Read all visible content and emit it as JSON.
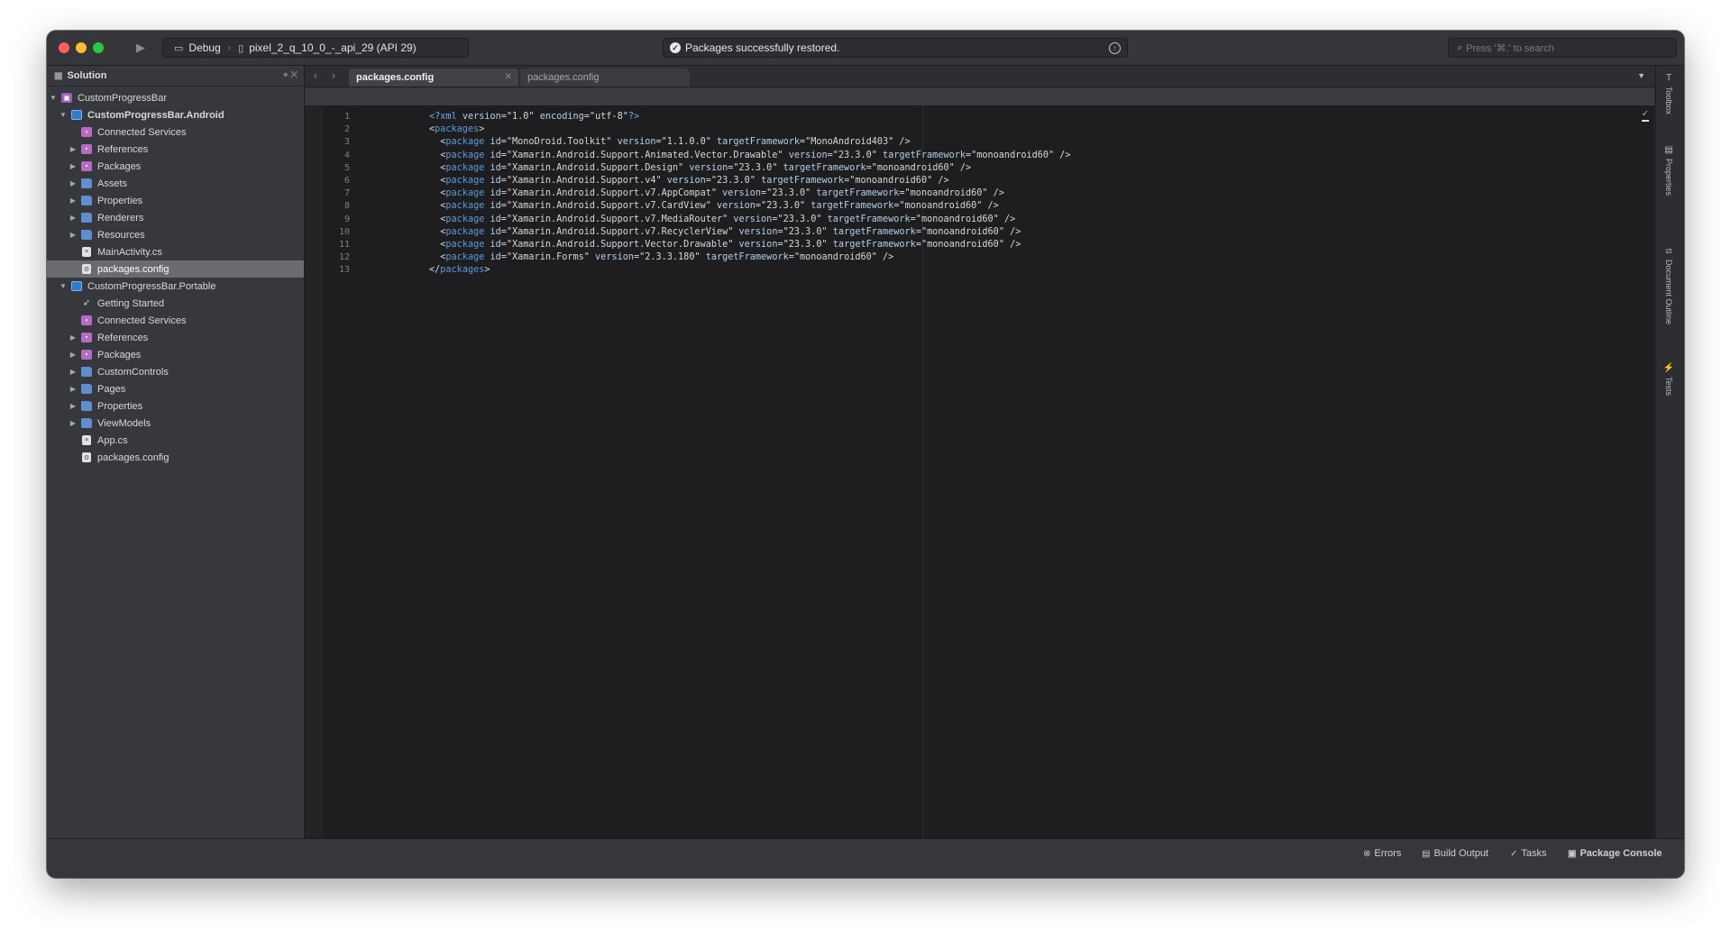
{
  "toolbar": {
    "run_icon": "play-icon",
    "configuration": "Debug",
    "device": "pixel_2_q_10_0_-_api_29 (API 29)",
    "status_message": "Packages successfully restored.",
    "search_placeholder": "Press '⌘.' to search"
  },
  "sidebar": {
    "title": "Solution",
    "tree": [
      {
        "label": "CustomProgressBar",
        "indent": 0,
        "arrow": "down",
        "icon": "solution-icon",
        "bold": false
      },
      {
        "label": "CustomProgressBar.Android",
        "indent": 1,
        "arrow": "down",
        "icon": "project-icon",
        "bold": true
      },
      {
        "label": "Connected Services",
        "indent": 2,
        "arrow": "",
        "icon": "connected-services-icon",
        "bold": false
      },
      {
        "label": "References",
        "indent": 2,
        "arrow": "right",
        "icon": "references-folder-icon",
        "bold": false
      },
      {
        "label": "Packages",
        "indent": 2,
        "arrow": "right",
        "icon": "packages-folder-icon",
        "bold": false
      },
      {
        "label": "Assets",
        "indent": 2,
        "arrow": "right",
        "icon": "folder-icon",
        "bold": false
      },
      {
        "label": "Properties",
        "indent": 2,
        "arrow": "right",
        "icon": "folder-icon",
        "bold": false
      },
      {
        "label": "Renderers",
        "indent": 2,
        "arrow": "right",
        "icon": "folder-icon",
        "bold": false
      },
      {
        "label": "Resources",
        "indent": 2,
        "arrow": "right",
        "icon": "folder-icon",
        "bold": false
      },
      {
        "label": "MainActivity.cs",
        "indent": 2,
        "arrow": "",
        "icon": "file-icon",
        "bold": false
      },
      {
        "label": "packages.config",
        "indent": 2,
        "arrow": "",
        "icon": "config-file-icon",
        "bold": false,
        "selected": true
      },
      {
        "label": "CustomProgressBar.Portable",
        "indent": 1,
        "arrow": "down",
        "icon": "project-icon",
        "bold": false
      },
      {
        "label": "Getting Started",
        "indent": 2,
        "arrow": "",
        "icon": "rocket-icon",
        "bold": false
      },
      {
        "label": "Connected Services",
        "indent": 2,
        "arrow": "",
        "icon": "connected-services-icon",
        "bold": false
      },
      {
        "label": "References",
        "indent": 2,
        "arrow": "right",
        "icon": "references-folder-icon",
        "bold": false
      },
      {
        "label": "Packages",
        "indent": 2,
        "arrow": "right",
        "icon": "packages-folder-icon",
        "bold": false
      },
      {
        "label": "CustomControls",
        "indent": 2,
        "arrow": "right",
        "icon": "folder-icon",
        "bold": false
      },
      {
        "label": "Pages",
        "indent": 2,
        "arrow": "right",
        "icon": "folder-icon",
        "bold": false
      },
      {
        "label": "Properties",
        "indent": 2,
        "arrow": "right",
        "icon": "folder-icon",
        "bold": false
      },
      {
        "label": "ViewModels",
        "indent": 2,
        "arrow": "right",
        "icon": "folder-icon",
        "bold": false
      },
      {
        "label": "App.cs",
        "indent": 2,
        "arrow": "",
        "icon": "file-icon",
        "bold": false
      },
      {
        "label": "packages.config",
        "indent": 2,
        "arrow": "",
        "icon": "config-file-icon",
        "bold": false
      }
    ]
  },
  "tabs": [
    {
      "label": "packages.config",
      "active": true
    },
    {
      "label": "packages.config",
      "active": false
    }
  ],
  "editor": {
    "lines": [
      {
        "n": "1",
        "segs": [
          [
            "pi",
            "<?xml "
          ],
          [
            "attr",
            "version"
          ],
          [
            "val",
            "=\"1.0\" "
          ],
          [
            "attr",
            "encoding"
          ],
          [
            "val",
            "=\"utf-8\""
          ],
          [
            "pi",
            "?>"
          ]
        ]
      },
      {
        "n": "2",
        "segs": [
          [
            "val",
            "<"
          ],
          [
            "tag",
            "packages"
          ],
          [
            "val",
            ">"
          ]
        ]
      },
      {
        "n": "3",
        "segs": [
          [
            "val",
            "  <"
          ],
          [
            "tag",
            "package "
          ],
          [
            "attr",
            "id"
          ],
          [
            "val",
            "=\"MonoDroid.Toolkit\" "
          ],
          [
            "attr",
            "version"
          ],
          [
            "val",
            "=\"1.1.0.0\" "
          ],
          [
            "attr",
            "targetFramework"
          ],
          [
            "val",
            "=\"MonoAndroid403\" />"
          ]
        ]
      },
      {
        "n": "4",
        "segs": [
          [
            "val",
            "  <"
          ],
          [
            "tag",
            "package "
          ],
          [
            "attr",
            "id"
          ],
          [
            "val",
            "=\"Xamarin.Android.Support.Animated.Vector.Drawable\" "
          ],
          [
            "attr",
            "version"
          ],
          [
            "val",
            "=\"23.3.0\" "
          ],
          [
            "attr",
            "targetFramework"
          ],
          [
            "val",
            "=\"monoandroid60\" />"
          ]
        ]
      },
      {
        "n": "5",
        "segs": [
          [
            "val",
            "  <"
          ],
          [
            "tag",
            "package "
          ],
          [
            "attr",
            "id"
          ],
          [
            "val",
            "=\"Xamarin.Android.Support.Design\" "
          ],
          [
            "attr",
            "version"
          ],
          [
            "val",
            "=\"23.3.0\" "
          ],
          [
            "attr",
            "targetFramework"
          ],
          [
            "val",
            "=\"monoandroid60\" />"
          ]
        ]
      },
      {
        "n": "6",
        "segs": [
          [
            "val",
            "  <"
          ],
          [
            "tag",
            "package "
          ],
          [
            "attr",
            "id"
          ],
          [
            "val",
            "=\"Xamarin.Android.Support.v4\" "
          ],
          [
            "attr",
            "version"
          ],
          [
            "val",
            "=\"23.3.0\" "
          ],
          [
            "attr",
            "targetFramework"
          ],
          [
            "val",
            "=\"monoandroid60\" />"
          ]
        ]
      },
      {
        "n": "7",
        "segs": [
          [
            "val",
            "  <"
          ],
          [
            "tag",
            "package "
          ],
          [
            "attr",
            "id"
          ],
          [
            "val",
            "=\"Xamarin.Android.Support.v7.AppCompat\" "
          ],
          [
            "attr",
            "version"
          ],
          [
            "val",
            "=\"23.3.0\" "
          ],
          [
            "attr",
            "targetFramework"
          ],
          [
            "val",
            "=\"monoandroid60\" />"
          ]
        ]
      },
      {
        "n": "8",
        "segs": [
          [
            "val",
            "  <"
          ],
          [
            "tag",
            "package "
          ],
          [
            "attr",
            "id"
          ],
          [
            "val",
            "=\"Xamarin.Android.Support.v7.CardView\" "
          ],
          [
            "attr",
            "version"
          ],
          [
            "val",
            "=\"23.3.0\" "
          ],
          [
            "attr",
            "targetFramework"
          ],
          [
            "val",
            "=\"monoandroid60\" />"
          ]
        ]
      },
      {
        "n": "9",
        "segs": [
          [
            "val",
            "  <"
          ],
          [
            "tag",
            "package "
          ],
          [
            "attr",
            "id"
          ],
          [
            "val",
            "=\"Xamarin.Android.Support.v7.MediaRouter\" "
          ],
          [
            "attr",
            "version"
          ],
          [
            "val",
            "=\"23.3.0\" "
          ],
          [
            "attr",
            "targetFramework"
          ],
          [
            "val",
            "=\"monoandroid60\" />"
          ]
        ]
      },
      {
        "n": "10",
        "segs": [
          [
            "val",
            "  <"
          ],
          [
            "tag",
            "package "
          ],
          [
            "attr",
            "id"
          ],
          [
            "val",
            "=\"Xamarin.Android.Support.v7.RecyclerView\" "
          ],
          [
            "attr",
            "version"
          ],
          [
            "val",
            "=\"23.3.0\" "
          ],
          [
            "attr",
            "targetFramework"
          ],
          [
            "val",
            "=\"monoandroid60\" />"
          ]
        ]
      },
      {
        "n": "11",
        "segs": [
          [
            "val",
            "  <"
          ],
          [
            "tag",
            "package "
          ],
          [
            "attr",
            "id"
          ],
          [
            "val",
            "=\"Xamarin.Android.Support.Vector.Drawable\" "
          ],
          [
            "attr",
            "version"
          ],
          [
            "val",
            "=\"23.3.0\" "
          ],
          [
            "attr",
            "targetFramework"
          ],
          [
            "val",
            "=\"monoandroid60\" />"
          ]
        ]
      },
      {
        "n": "12",
        "segs": [
          [
            "val",
            "  <"
          ],
          [
            "tag",
            "package "
          ],
          [
            "attr",
            "id"
          ],
          [
            "val",
            "=\"Xamarin.Forms\" "
          ],
          [
            "attr",
            "version"
          ],
          [
            "val",
            "=\"2.3.3.180\" "
          ],
          [
            "attr",
            "targetFramework"
          ],
          [
            "val",
            "=\"monoandroid60\" />"
          ]
        ]
      },
      {
        "n": "13",
        "segs": [
          [
            "val",
            "</"
          ],
          [
            "tag",
            "packages"
          ],
          [
            "val",
            ">"
          ]
        ]
      }
    ]
  },
  "right_rail": [
    "Toolbox",
    "Properties",
    "Document Outline",
    "Tests"
  ],
  "statusbar": {
    "errors": "Errors",
    "build_output": "Build Output",
    "tasks": "Tasks",
    "package_console": "Package Console"
  },
  "colors": {
    "window_bg": "#2b2c30",
    "editor_bg": "#1e1e20",
    "sidebar_bg": "#36383e",
    "selection": "#6a6b70",
    "xml_tag": "#5c9ad8",
    "xml_attr": "#b5cfe6"
  }
}
